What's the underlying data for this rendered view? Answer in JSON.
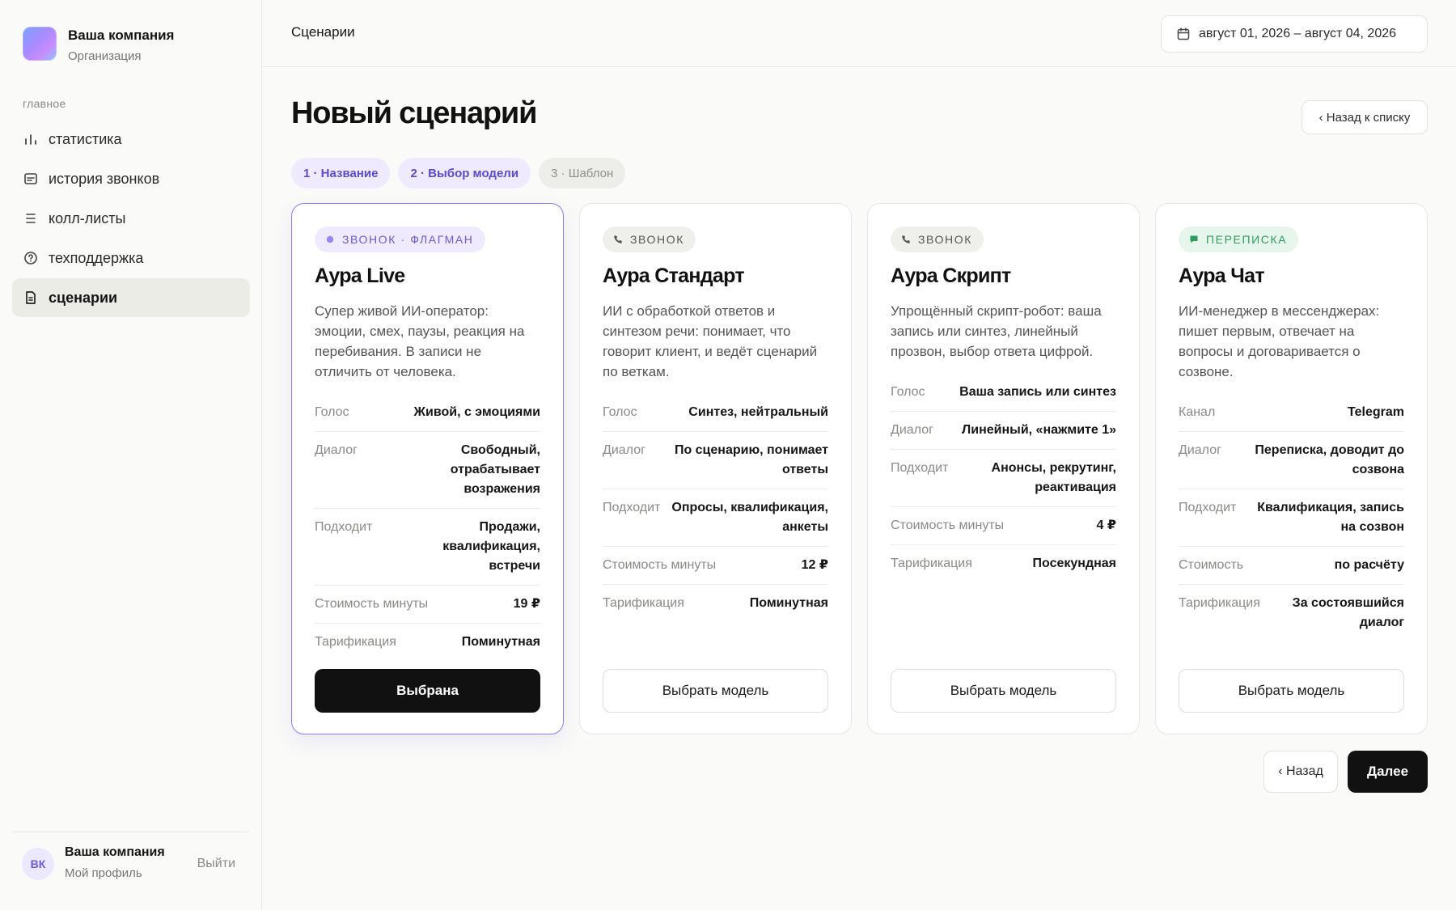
{
  "sidebar": {
    "org_name": "Ваша компания",
    "org_sub": "Организация",
    "section": "главное",
    "items": [
      {
        "label": "статистика",
        "icon": "bar-chart-icon"
      },
      {
        "label": "история звонков",
        "icon": "message-square-icon"
      },
      {
        "label": "колл-листы",
        "icon": "list-icon"
      },
      {
        "label": "техподдержка",
        "icon": "help-circle-icon"
      },
      {
        "label": "сценарии",
        "icon": "document-icon",
        "active": true
      }
    ],
    "profile": {
      "initials": "ВК",
      "name": "Ваша компания",
      "sub": "Мой профиль",
      "logout": "Выйти"
    }
  },
  "header": {
    "breadcrumb": "Сценарии",
    "date_range": "август 01, 2026 – август 04, 2026"
  },
  "main": {
    "title": "Новый сценарий",
    "back_to_list": "‹ Назад к списку",
    "steps": [
      {
        "label": "1 · Название",
        "state": "done"
      },
      {
        "label": "2 · Выбор модели",
        "state": "done"
      },
      {
        "label": "3 · Шаблон",
        "state": "todo"
      }
    ],
    "cards": [
      {
        "badge": "ЗВОНОК · ФЛАГМАН",
        "badge_icon": "dot-icon",
        "title": "Аура Live",
        "desc": "Супер живой ИИ-оператор: эмоции, смех, паузы, реакция на перебивания. В записи не отличить от человека.",
        "specs": [
          {
            "k": "Голос",
            "v": "Живой, с эмоциями"
          },
          {
            "k": "Диалог",
            "v": "Свободный, отрабатывает возражения"
          },
          {
            "k": "Подходит",
            "v": "Продажи, квалификация, встречи"
          },
          {
            "k": "Стоимость минуты",
            "v": "19 ₽"
          },
          {
            "k": "Тарификация",
            "v": "Поминутная"
          }
        ],
        "button": "Выбрана"
      },
      {
        "badge": "ЗВОНОК",
        "badge_icon": "phone-icon",
        "title": "Аура Стандарт",
        "desc": "ИИ с обработкой ответов и синтезом речи: понимает, что говорит клиент, и ведёт сценарий по веткам.",
        "specs": [
          {
            "k": "Голос",
            "v": "Синтез, нейтральный"
          },
          {
            "k": "Диалог",
            "v": "По сценарию, понимает ответы"
          },
          {
            "k": "Подходит",
            "v": "Опросы, квалификация, анкеты"
          },
          {
            "k": "Стоимость минуты",
            "v": "12 ₽"
          },
          {
            "k": "Тарификация",
            "v": "Поминутная"
          }
        ],
        "button": "Выбрать модель"
      },
      {
        "badge": "ЗВОНОК",
        "badge_icon": "phone-icon",
        "title": "Аура Скрипт",
        "desc": "Упрощённый скрипт-робот: ваша запись или синтез, линейный прозвон, выбор ответа цифрой.",
        "specs": [
          {
            "k": "Голос",
            "v": "Ваша запись или синтез"
          },
          {
            "k": "Диалог",
            "v": "Линейный, «нажмите 1»"
          },
          {
            "k": "Подходит",
            "v": "Анонсы, рекрутинг, реактивация"
          },
          {
            "k": "Стоимость минуты",
            "v": "4 ₽"
          },
          {
            "k": "Тарификация",
            "v": "Посекундная"
          }
        ],
        "button": "Выбрать модель"
      },
      {
        "badge": "ПЕРЕПИСКА",
        "badge_icon": "chat-icon",
        "title": "Аура Чат",
        "desc": "ИИ-менеджер в мессенджерах: пишет первым, отвечает на вопросы и договаривается о созвоне.",
        "specs": [
          {
            "k": "Канал",
            "v": "Telegram"
          },
          {
            "k": "Диалог",
            "v": "Переписка, доводит до созвона"
          },
          {
            "k": "Подходит",
            "v": "Квалификация, запись на созвон"
          },
          {
            "k": "Стоимость",
            "v": "по расчёту"
          },
          {
            "k": "Тарификация",
            "v": "За состоявшийся диалог"
          }
        ],
        "button": "Выбрать модель"
      }
    ],
    "back": "‹ Назад",
    "next": "Далее"
  },
  "colors": {
    "accent": "#6c5bd6",
    "accent_bg": "#efeafd",
    "chat_badge": "#2e9b5b",
    "primary_button": "#111111"
  }
}
